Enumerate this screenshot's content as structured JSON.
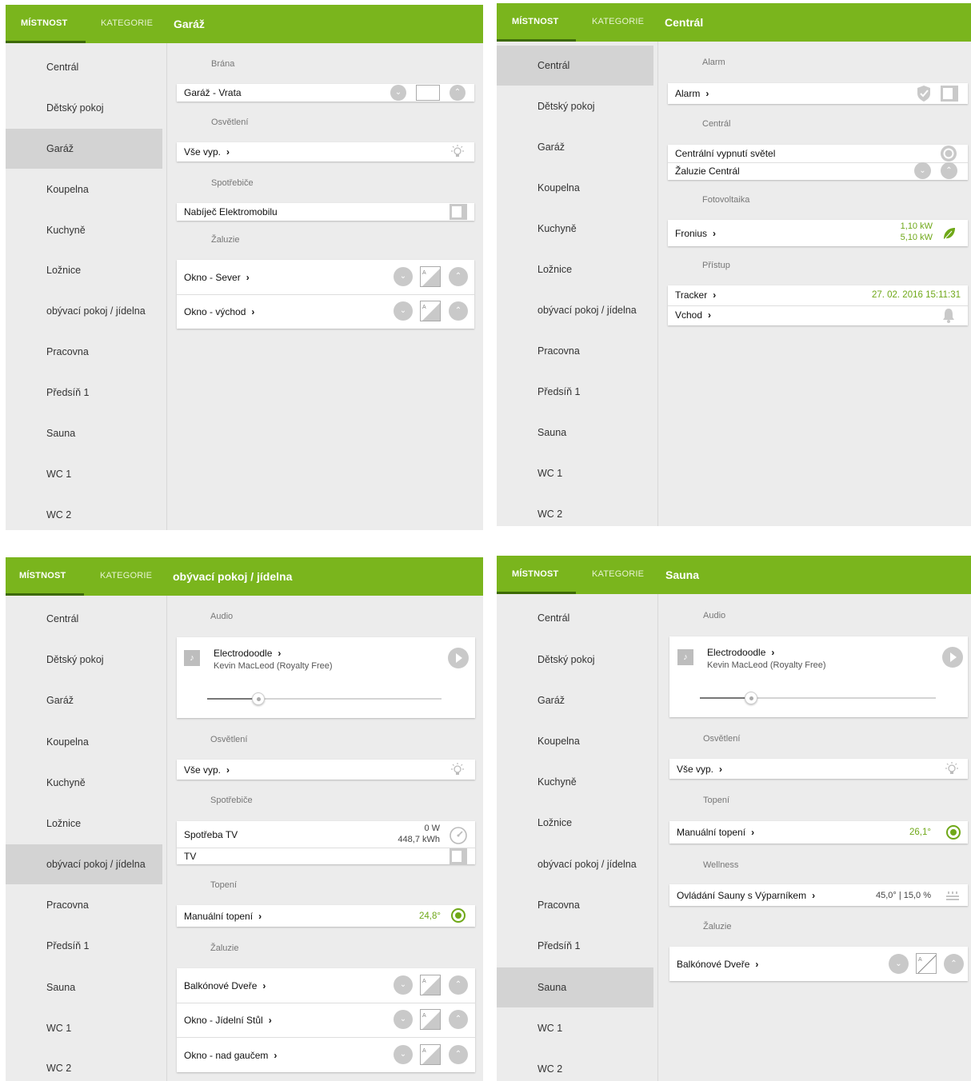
{
  "colors": {
    "accent": "#7ab51d",
    "accent_dark": "#3d6a06",
    "value_green": "#6fa818"
  },
  "nav": {
    "tab_room": "MÍSTNOST",
    "tab_category": "KATEGORIE"
  },
  "rooms": [
    "Centrál",
    "Dětský pokoj",
    "Garáž",
    "Koupelna",
    "Kuchyně",
    "Ložnice",
    "obývací pokoj / jídelna",
    "Pracovna",
    "Předsíň 1",
    "Sauna",
    "WC 1",
    "WC 2"
  ],
  "panels": [
    {
      "title": "Garáž",
      "selected_room": "Garáž",
      "sections": {
        "brana": "Brána",
        "osvetleni": "Osvětlení",
        "spotrebice": "Spotřebiče",
        "zaluzie": "Žaluzie"
      },
      "items": {
        "gate": "Garáž - Vrata",
        "lights_all_off": "Vše vyp.",
        "ev_charger": "Nabíječ Elektromobilu",
        "window_north": "Okno - Sever",
        "window_east": "Okno - východ"
      }
    },
    {
      "title": "Centrál",
      "selected_room": "Centrál",
      "sections": {
        "alarm": "Alarm",
        "central": "Centrál",
        "pv": "Fotovoltaika",
        "access": "Přístup"
      },
      "items": {
        "alarm": "Alarm",
        "central_lights_off": "Centrální vypnutí světel",
        "blinds_central": "Žaluzie Centrál",
        "fronius": "Fronius",
        "fronius_power_1": "1,10 kW",
        "fronius_power_2": "5,10 kW",
        "tracker": "Tracker",
        "tracker_time": "27. 02. 2016 15:11:31",
        "entrance": "Vchod"
      }
    },
    {
      "title": "obývací pokoj / jídelna",
      "selected_room": "obývací pokoj / jídelna",
      "sections": {
        "audio": "Audio",
        "osvetleni": "Osvětlení",
        "spotrebice": "Spotřebiče",
        "topeni": "Topení",
        "zaluzie": "Žaluzie"
      },
      "audio": {
        "track": "Electrodoodle",
        "artist": "Kevin MacLeod (Royalty Free)",
        "position": 0.22
      },
      "items": {
        "lights_all_off": "Vše vyp.",
        "tv_consumption": "Spotřeba TV",
        "tv_power": "0 W",
        "tv_energy": "448,7 kWh",
        "tv": "TV",
        "manual_heating": "Manuální topení",
        "heating_temp": "24,8°",
        "balcony_doors": "Balkónové Dveře",
        "window_dining": "Okno - Jídelní Stůl",
        "window_couch": "Okno - nad gaučem"
      }
    },
    {
      "title": "Sauna",
      "selected_room": "Sauna",
      "sections": {
        "audio": "Audio",
        "osvetleni": "Osvětlení",
        "topeni": "Topení",
        "wellness": "Wellness",
        "zaluzie": "Žaluzie"
      },
      "audio": {
        "track": "Electrodoodle",
        "artist": "Kevin MacLeod (Royalty Free)",
        "position": 0.22
      },
      "items": {
        "lights_all_off": "Vše vyp.",
        "manual_heating": "Manuální topení",
        "heating_temp": "26,1°",
        "sauna_control": "Ovládání Sauny s Výparníkem",
        "sauna_values": "45,0° | 15,0 %",
        "balcony_doors": "Balkónové Dveře"
      }
    }
  ],
  "icons": {
    "chevron": "›",
    "down": "⌄",
    "up": "⌃",
    "note": "♪"
  }
}
